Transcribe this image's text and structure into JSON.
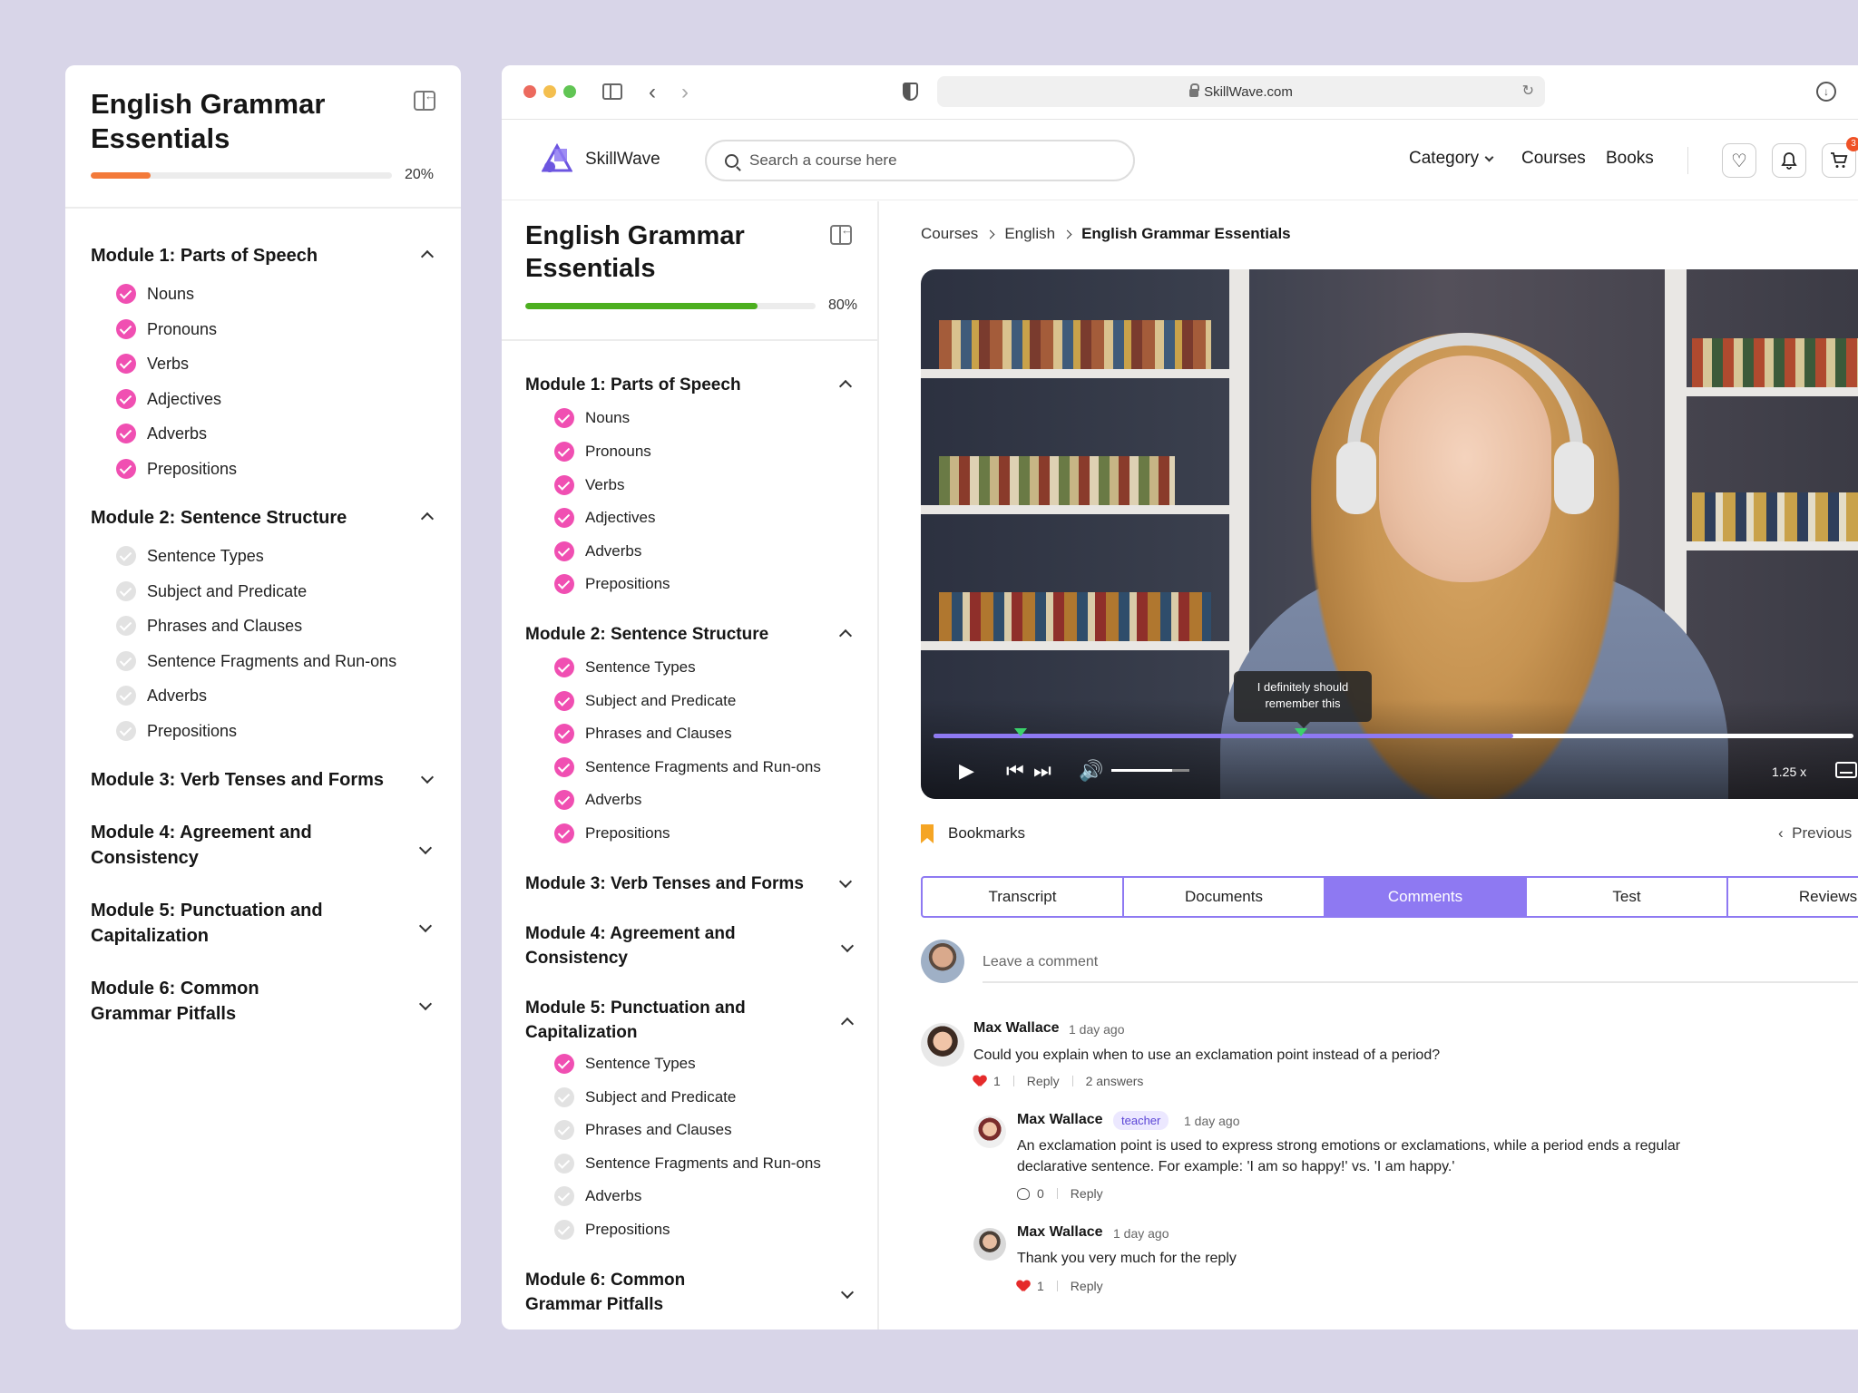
{
  "left_panel": {
    "title": "English Grammar Essentials",
    "progress_percent": 20,
    "progress_label": "20%",
    "progress_color": "#f37a3a",
    "modules": [
      {
        "title": "Module 1: Parts of Speech",
        "expanded": true,
        "lessons": [
          {
            "label": "Nouns",
            "done": true
          },
          {
            "label": "Pronouns",
            "done": true
          },
          {
            "label": "Verbs",
            "done": true
          },
          {
            "label": "Adjectives",
            "done": true
          },
          {
            "label": "Adverbs",
            "done": true
          },
          {
            "label": "Prepositions",
            "done": true
          }
        ]
      },
      {
        "title": "Module 2: Sentence Structure",
        "expanded": true,
        "lessons": [
          {
            "label": "Sentence Types",
            "done": false
          },
          {
            "label": "Subject and Predicate",
            "done": false
          },
          {
            "label": "Phrases and Clauses",
            "done": false
          },
          {
            "label": "Sentence Fragments and Run-ons",
            "done": false
          },
          {
            "label": "Adverbs",
            "done": false
          },
          {
            "label": "Prepositions",
            "done": false
          }
        ]
      },
      {
        "title": "Module 3: Verb Tenses and Forms",
        "expanded": false
      },
      {
        "title": "Module 4: Agreement and Consistency",
        "expanded": false
      },
      {
        "title": "Module 5: Punctuation and Capitalization",
        "expanded": false
      },
      {
        "title": "Module 6: Common Grammar Pitfalls",
        "expanded": false
      }
    ]
  },
  "browser": {
    "url": "SkillWave.com",
    "traffic_lights": [
      "#ec6a5e",
      "#f4bf4f",
      "#61c554"
    ]
  },
  "header": {
    "brand": "SkillWave",
    "search_placeholder": "Search a course here",
    "nav": {
      "category": "Category",
      "courses": "Courses",
      "books": "Books"
    },
    "cart_count": "3",
    "accent": "#8e79f2"
  },
  "inner_sidebar": {
    "title": "English Grammar Essentials",
    "progress_percent": 80,
    "progress_label": "80%",
    "progress_color": "#4caf1f",
    "modules": [
      {
        "title": "Module 1: Parts of Speech",
        "expanded": true,
        "lessons": [
          {
            "label": "Nouns",
            "done": true
          },
          {
            "label": "Pronouns",
            "done": true
          },
          {
            "label": "Verbs",
            "done": true
          },
          {
            "label": "Adjectives",
            "done": true
          },
          {
            "label": "Adverbs",
            "done": true
          },
          {
            "label": "Prepositions",
            "done": true
          }
        ]
      },
      {
        "title": "Module 2: Sentence Structure",
        "expanded": true,
        "lessons": [
          {
            "label": "Sentence Types",
            "done": true
          },
          {
            "label": "Subject and Predicate",
            "done": true
          },
          {
            "label": "Phrases and Clauses",
            "done": true
          },
          {
            "label": "Sentence Fragments and Run-ons",
            "done": true
          },
          {
            "label": "Adverbs",
            "done": true
          },
          {
            "label": "Prepositions",
            "done": true
          }
        ]
      },
      {
        "title": "Module 3: Verb Tenses and Forms",
        "expanded": false
      },
      {
        "title": "Module 4: Agreement and Consistency",
        "expanded": false
      },
      {
        "title": "Module 5: Punctuation and Capitalization",
        "expanded": true,
        "lessons": [
          {
            "label": "Sentence Types",
            "done": true
          },
          {
            "label": "Subject and Predicate",
            "done": false
          },
          {
            "label": "Phrases and Clauses",
            "done": false
          },
          {
            "label": "Sentence Fragments and Run-ons",
            "done": false
          },
          {
            "label": "Adverbs",
            "done": false
          },
          {
            "label": "Prepositions",
            "done": false
          }
        ]
      },
      {
        "title": "Module 6: Common Grammar Pitfalls",
        "expanded": false
      }
    ]
  },
  "breadcrumb": [
    "Courses",
    "English",
    "English Grammar Essentials"
  ],
  "video": {
    "tooltip": "I definitely should remember this",
    "played_fraction": 0.63,
    "volume_fraction": 0.78,
    "speed": "1.25 x"
  },
  "bookmarks_label": "Bookmarks",
  "previous_label": "Previous",
  "tabs": [
    "Transcript",
    "Documents",
    "Comments",
    "Test",
    "Reviews"
  ],
  "active_tab": "Comments",
  "comments": {
    "placeholder": "Leave a comment",
    "items": [
      {
        "name": "Max Wallace",
        "time": "1 day ago",
        "text": "Could you explain when to use an exclamation point instead of a period?",
        "likes": "1",
        "reply": "Reply",
        "answers": "2 answers"
      },
      {
        "name": "Max Wallace",
        "badge": "teacher",
        "time": "1 day ago",
        "text": "An exclamation point is used to express strong emotions or exclamations, while a period ends a regular declarative sentence. For example: 'I am so happy!' vs. 'I am happy.'",
        "likes": "0",
        "reply": "Reply"
      },
      {
        "name": "Max Wallace",
        "time": "1 day ago",
        "text": "Thank you very much for the reply",
        "likes": "1",
        "reply": "Reply"
      }
    ]
  }
}
